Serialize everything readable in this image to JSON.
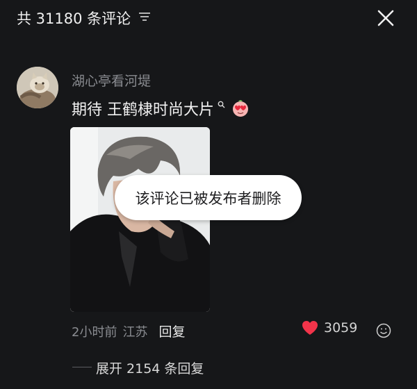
{
  "header": {
    "title": "共 31180 条评论"
  },
  "comment": {
    "username": "湖心亭看河堤",
    "text": "期待 王鹤棣时尚大片",
    "deleted_notice": "该评论已被发布者删除",
    "time": "2小时前",
    "location": "江苏",
    "reply_label": "回复",
    "like_count": "3059",
    "liked": true
  },
  "replies": {
    "expand_label": "展开 2154 条回复"
  },
  "icons": {
    "sort": "sort-lines-icon",
    "close": "close-icon",
    "search": "search-icon",
    "emoji": "heart-eyes-emoji-icon",
    "heart": "heart-icon",
    "react": "emoji-react-icon"
  },
  "colors": {
    "background": "#161719",
    "heart": "#f2344a",
    "muted": "#8a8c91"
  }
}
